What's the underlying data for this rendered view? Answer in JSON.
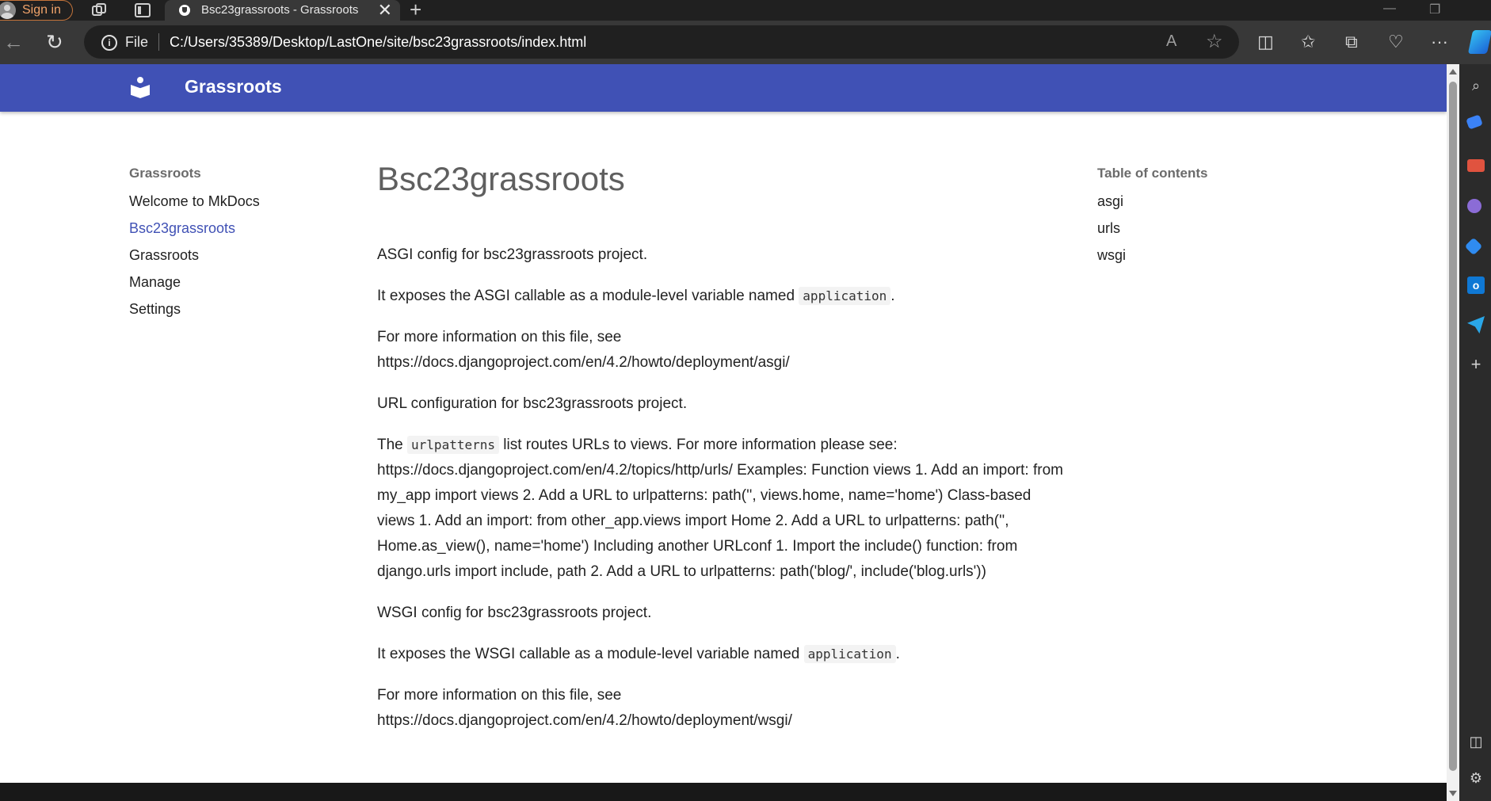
{
  "browser": {
    "signin_label": "Sign in",
    "tab_title": "Bsc23grassroots - Grassroots",
    "tab_close": "✕",
    "new_tab": "+",
    "win_min": "—",
    "win_max": "❐",
    "scheme": "File",
    "url": "C:/Users/35389/Desktop/LastOne/site/bsc23grassroots/index.html",
    "back_icon": "←",
    "reload_icon": "↻",
    "read_aloud_icon": "A",
    "favorite_icon": "☆",
    "split_icon": "◫",
    "favorites_icon": "✩",
    "collections_icon": "⧉",
    "health_icon": "♡",
    "more_icon": "···"
  },
  "site": {
    "name": "Grassroots"
  },
  "nav": {
    "title": "Grassroots",
    "items": [
      {
        "label": "Welcome to MkDocs"
      },
      {
        "label": "Bsc23grassroots"
      },
      {
        "label": "Grassroots"
      },
      {
        "label": "Manage"
      },
      {
        "label": "Settings"
      }
    ]
  },
  "toc": {
    "title": "Table of contents",
    "items": [
      {
        "label": "asgi"
      },
      {
        "label": "urls"
      },
      {
        "label": "wsgi"
      }
    ]
  },
  "content": {
    "title": "Bsc23grassroots",
    "p1": "ASGI config for bsc23grassroots project.",
    "p2_pre": "It exposes the ASGI callable as a module-level variable named ",
    "p2_code": "application",
    "p2_post": ".",
    "p3_line1": "For more information on this file, see",
    "p3_line2": "https://docs.djangoproject.com/en/4.2/howto/deployment/asgi/",
    "p4": "URL configuration for bsc23grassroots project.",
    "p5_pre": "The ",
    "p5_code": "urlpatterns",
    "p5_post": " list routes URLs to views. For more information please see: https://docs.djangoproject.com/en/4.2/topics/http/urls/ Examples: Function views 1. Add an import: from my_app import views 2. Add a URL to urlpatterns: path('', views.home, name='home') Class-based views 1. Add an import: from other_app.views import Home 2. Add a URL to urlpatterns: path('', Home.as_view(), name='home') Including another URLconf 1. Import the include() function: from django.urls import include, path 2. Add a URL to urlpatterns: path('blog/', include('blog.urls'))",
    "p6": "WSGI config for bsc23grassroots project.",
    "p7_pre": "It exposes the WSGI callable as a module-level variable named ",
    "p7_code": "application",
    "p7_post": ".",
    "p8_line1": "For more information on this file, see",
    "p8_line2": "https://docs.djangoproject.com/en/4.2/howto/deployment/wsgi/"
  },
  "sidebar_icons": [
    "search-icon",
    "tag-icon",
    "shopping-icon",
    "people-icon",
    "copilot-icon",
    "outlook-icon",
    "send-icon",
    "add-icon",
    "split-screen-icon",
    "settings-icon"
  ]
}
